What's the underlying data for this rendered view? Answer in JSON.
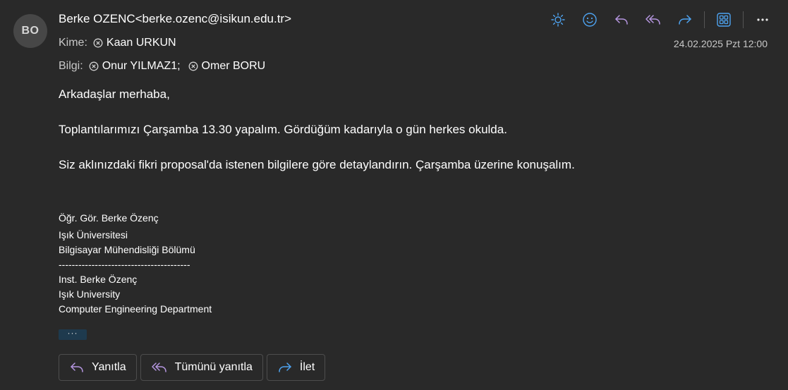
{
  "sender": {
    "initials": "BO",
    "display": "Berke OZENC<berke.ozenc@isikun.edu.tr>"
  },
  "to": {
    "label": "Kime:",
    "recipients": [
      "Kaan URKUN"
    ]
  },
  "cc": {
    "label": "Bilgi:",
    "recipients": [
      "Onur YILMAZ1;",
      "Omer BORU"
    ]
  },
  "date": "24.02.2025 Pzt 12:00",
  "toolbar": {
    "icons": [
      "sun-icon",
      "emoji-icon",
      "reply-icon",
      "reply-all-icon",
      "forward-icon",
      "apps-icon",
      "more-icon"
    ]
  },
  "body": {
    "greeting": "Arkadaşlar merhaba,",
    "paragraph1": "Toplantılarımızı Çarşamba 13.30 yapalım. Gördüğüm kadarıyla o gün herkes okulda.",
    "paragraph2": "Siz aklınızdaki fikri proposal'da istenen bilgilere göre detaylandırın. Çarşamba üzerine konuşalım."
  },
  "signature": {
    "lines": [
      "Öğr. Gör. Berke Özenç",
      "Işık Üniversitesi",
      "Bilgisayar Mühendisliği Bölümü",
      "----------------------------------------",
      "Inst. Berke Özenç",
      "Işık University",
      "Computer Engineering Department"
    ]
  },
  "more_label": "···",
  "actions": {
    "reply": "Yanıtla",
    "reply_all": "Tümünü yanıtla",
    "forward": "İlet"
  },
  "colors": {
    "background": "#292929",
    "accent_blue": "#4ea3f0",
    "accent_purple": "#b596e0"
  }
}
